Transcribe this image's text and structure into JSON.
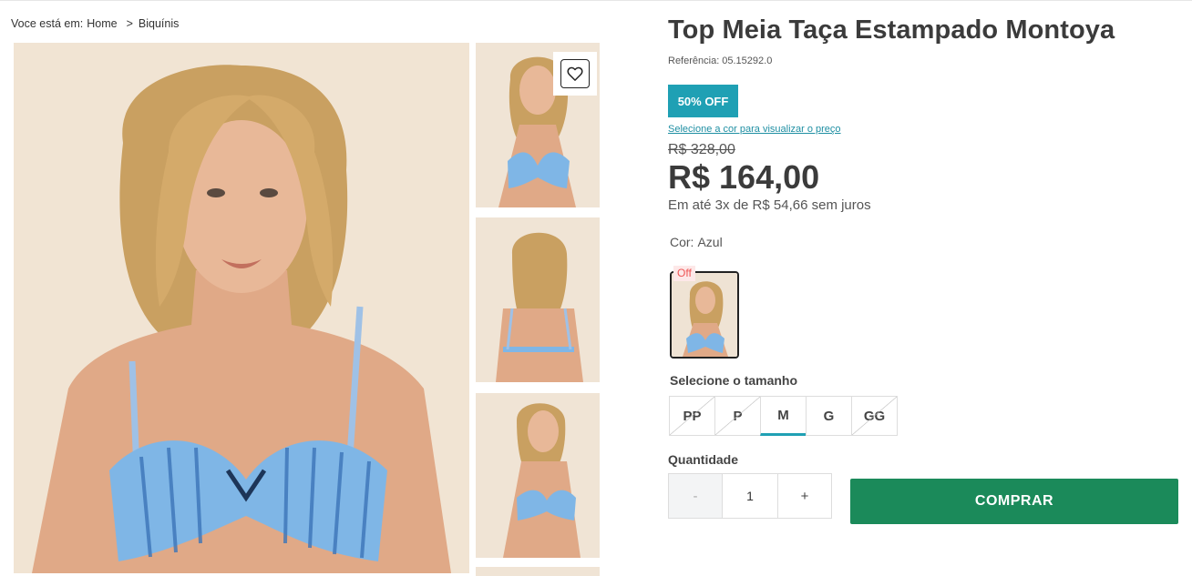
{
  "breadcrumb": {
    "lead": "Voce está em:",
    "items": [
      "Home",
      "Biquínis"
    ],
    "separator": ">"
  },
  "product": {
    "title": "Top Meia Taça Estampado Montoya",
    "reference_label": "Referência:",
    "reference": "05.15292.0",
    "discount_badge": "50% OFF",
    "select_color_link": "Selecione a cor para visualizar o preço",
    "old_price": "R$ 328,00",
    "price": "R$ 164,00",
    "installments": "Em até 3x de R$ 54,66 sem juros",
    "color_label": "Cor:",
    "color_value": "Azul",
    "swatch_badge": "Off",
    "size_label": "Selecione o tamanho",
    "sizes": [
      {
        "label": "PP",
        "available": false
      },
      {
        "label": "P",
        "available": false
      },
      {
        "label": "M",
        "available": true,
        "selected": true
      },
      {
        "label": "G",
        "available": true
      },
      {
        "label": "GG",
        "available": false
      }
    ],
    "quantity_label": "Quantidade",
    "quantity": "1",
    "minus": "-",
    "plus": "+",
    "buy_label": "COMPRAR"
  },
  "colors": {
    "accent": "#1fa0b4",
    "buy": "#1b8a5a",
    "title": "#3b3b3b"
  },
  "icons": {
    "favorite": "heart-icon"
  }
}
